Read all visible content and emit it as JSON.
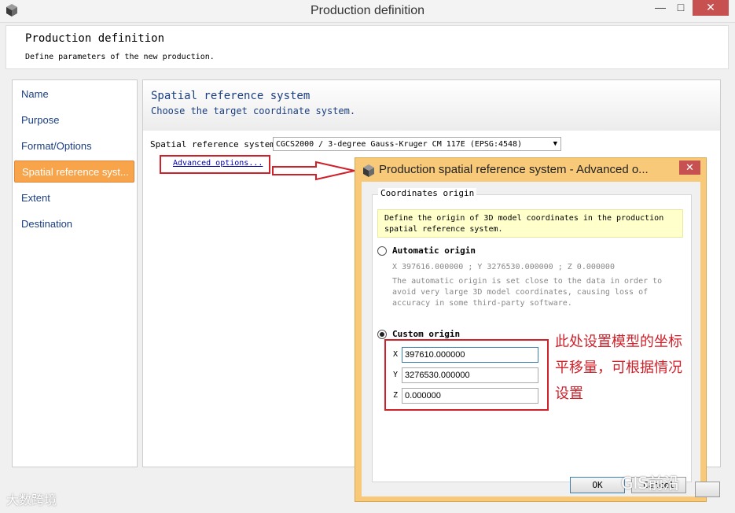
{
  "window": {
    "title": "Production definition",
    "minimize": "—",
    "maximize": "□",
    "close": "✕"
  },
  "header": {
    "title": "Production definition",
    "subtitle": "Define parameters of the new production."
  },
  "nav": {
    "items": [
      {
        "label": "Name"
      },
      {
        "label": "Purpose"
      },
      {
        "label": "Format/Options"
      },
      {
        "label": "Spatial reference syst..."
      },
      {
        "label": "Extent"
      },
      {
        "label": "Destination"
      }
    ],
    "active_index": 3
  },
  "content": {
    "title": "Spatial reference system",
    "subtitle": "Choose the target coordinate system.",
    "srs_label": "Spatial reference system:",
    "srs_value": "CGCS2000 / 3-degree Gauss-Kruger CM 117E (EPSG:4548)",
    "advanced_link": "Advanced options..."
  },
  "dialog": {
    "title": "Production spatial reference system - Advanced o...",
    "close": "✕",
    "group_label": "Coordinates origin",
    "note_line1": "Define the origin of 3D model coordinates in the production",
    "note_line2": "spatial reference system.",
    "auto_label": "Automatic origin",
    "auto_coords": "X 397616.000000 ; Y 3276530.000000 ; Z 0.000000",
    "auto_desc1": "The automatic origin is set close to the data in order to",
    "auto_desc2": "avoid very large 3D model coordinates, causing loss of",
    "auto_desc3": "accuracy in some third-party software.",
    "custom_label": "Custom origin",
    "x_letter": "X",
    "y_letter": "Y",
    "z_letter": "Z",
    "x_value": "397610.000000",
    "y_value": "3276530.000000",
    "z_value": "0.000000",
    "ok_label": "OK",
    "cancel_label": "Cancel"
  },
  "annotation": {
    "line1": "此处设置模型的坐标",
    "line2": "平移量，可根据情况",
    "line3": "设置"
  },
  "watermarks": {
    "left": "大数跨境",
    "right": "GIS前沿"
  },
  "colors": {
    "accent": "#f7a44a",
    "highlight": "#d0202a",
    "link": "#1a3e80"
  }
}
